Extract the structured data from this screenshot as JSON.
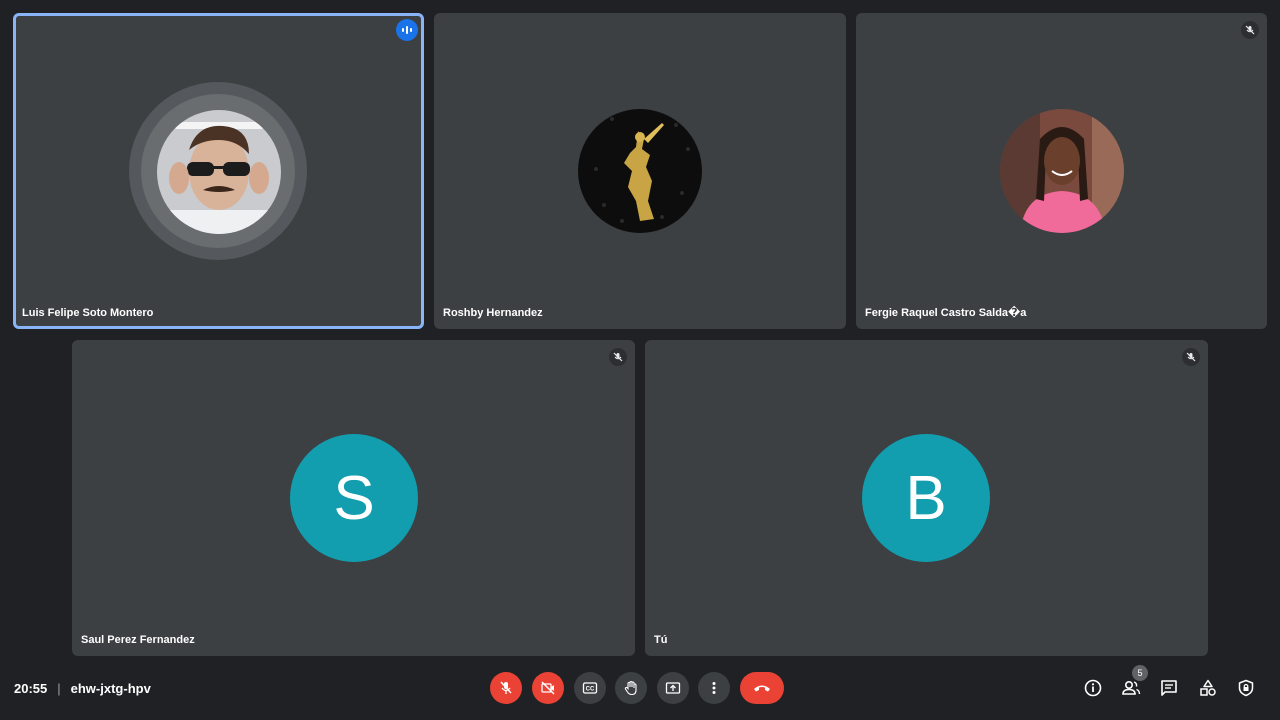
{
  "meeting": {
    "time": "20:55",
    "code": "ehw-jxtg-hpv"
  },
  "participants": [
    {
      "name": "Luis Felipe Soto Montero",
      "avatar": "photo-sunglasses",
      "speaking": true
    },
    {
      "name": "Roshby Hernandez",
      "avatar": "photo-gold-statue",
      "muted": false
    },
    {
      "name": "Fergie Raquel Castro Salda�a",
      "avatar": "photo-woman-pink",
      "muted": true
    },
    {
      "name": "Saul Perez Fernandez",
      "initial": "S",
      "muted": true
    },
    {
      "name": "Tú",
      "initial": "B",
      "muted": true
    }
  ],
  "participant_count": "5",
  "controls": [
    {
      "name": "mic-off-icon",
      "state": "off"
    },
    {
      "name": "camera-off-icon",
      "state": "off"
    },
    {
      "name": "captions-icon"
    },
    {
      "name": "raise-hand-icon"
    },
    {
      "name": "present-icon"
    },
    {
      "name": "more-options-icon"
    },
    {
      "name": "hang-up-icon"
    }
  ],
  "right_controls": [
    "info-icon",
    "people-icon",
    "chat-icon",
    "activities-icon",
    "host-controls-icon"
  ],
  "colors": {
    "background": "#202124",
    "tile": "#3c4043",
    "active_outline": "#8ab4f8",
    "avatar_teal": "#129eaf",
    "danger": "#ea4335",
    "speaking_blue": "#1a73e8"
  }
}
